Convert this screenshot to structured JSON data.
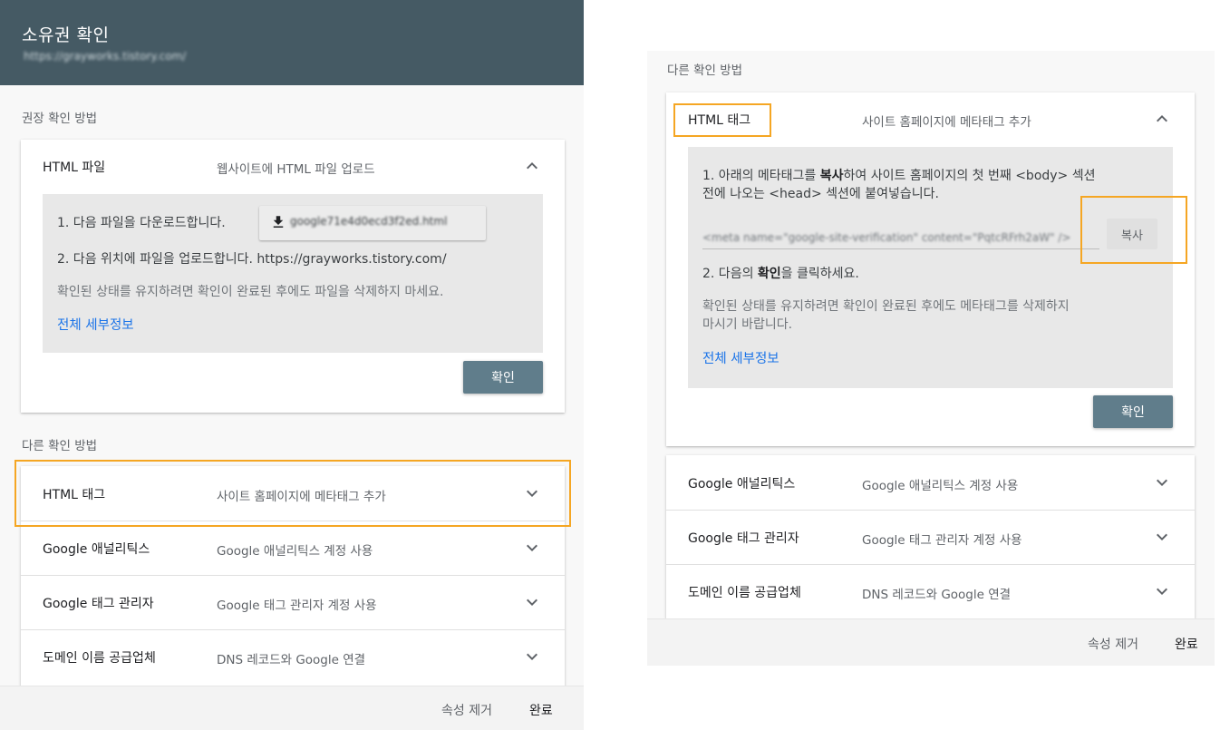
{
  "left": {
    "header": {
      "title": "소유권 확인",
      "url": "https://grayworks.tistory.com/"
    },
    "recommended_label": "권장 확인 방법",
    "html_file": {
      "name": "HTML 파일",
      "desc": "웹사이트에 HTML 파일 업로드",
      "step1": "1. 다음 파일을 다운로드합니다.",
      "filename": "google71e4d0ecd3f2ed.html",
      "step2": "2. 다음 위치에 파일을 업로드합니다. https://grayworks.tistory.com/",
      "note": "확인된 상태를 유지하려면 확인이 완료된 후에도 파일을 삭제하지 마세요.",
      "details_link": "전체 세부정보",
      "verify_button": "확인"
    },
    "other_label": "다른 확인 방법",
    "methods": [
      {
        "name": "HTML 태그",
        "desc": "사이트 홈페이지에 메타태그 추가"
      },
      {
        "name": "Google 애널리틱스",
        "desc": "Google 애널리틱스 계정 사용"
      },
      {
        "name": "Google 태그 관리자",
        "desc": "Google 태그 관리자 계정 사용"
      },
      {
        "name": "도메인 이름 공급업체",
        "desc": "DNS 레코드와 Google 연결"
      }
    ],
    "footer": {
      "remove": "속성 제거",
      "done": "완료"
    }
  },
  "right": {
    "other_label": "다른 확인 방법",
    "html_tag": {
      "name": "HTML 태그",
      "desc": "사이트 홈페이지에 메타태그 추가",
      "step1_pre": "1. 아래의 메타태그를 ",
      "step1_bold": "복사",
      "step1_post": "하여 사이트 홈페이지의 첫 번째 <body> 섹션",
      "step1_line2": "전에 나오는 <head> 섹션에 붙여넣습니다.",
      "meta_tag": "<meta name=\"google-site-verification\" content=\"PqtcRFrh2aW\" />",
      "copy_button": "복사",
      "step2_pre": "2. 다음의 ",
      "step2_bold": "확인",
      "step2_post": "을 클릭하세요.",
      "note_line1": "확인된 상태를 유지하려면 확인이 완료된 후에도 메타태그를 삭제하지",
      "note_line2": "마시기 바랍니다.",
      "details_link": "전체 세부정보",
      "verify_button": "확인"
    },
    "methods": [
      {
        "name": "Google 애널리틱스",
        "desc": "Google 애널리틱스 계정 사용"
      },
      {
        "name": "Google 태그 관리자",
        "desc": "Google 태그 관리자 계정 사용"
      },
      {
        "name": "도메인 이름 공급업체",
        "desc": "DNS 레코드와 Google 연결"
      }
    ],
    "footer": {
      "remove": "속성 제거",
      "done": "완료"
    }
  },
  "colors": {
    "header": "#455a64",
    "primary_button": "#607d8b",
    "link": "#1a73e8",
    "highlight": "#f5a623"
  }
}
